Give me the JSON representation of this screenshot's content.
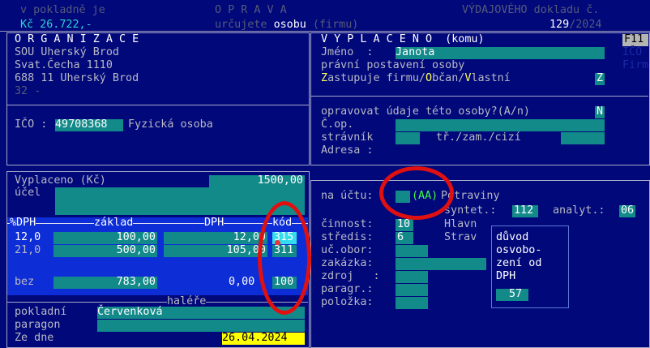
{
  "top": {
    "left_line1": "v pokladně je",
    "left_line2": "Kč 26.722,-",
    "title": "O P R A V A",
    "subtitle_pre": "určujete ",
    "subtitle_hl": "osobu",
    "subtitle_post": " (firmu)",
    "doc_label": "VÝDAJOVÉHO dokladu č.",
    "doc_number": "129",
    "doc_year": "/2024"
  },
  "org": {
    "title": "O R G A N I Z A C E",
    "name": "SOU Uherský Brod",
    "street": "Svat.Čecha 1110",
    "city": "688 11 Uherský Brod",
    "code": "32 -",
    "ico_label": "IČO :",
    "ico_value": "49708368",
    "ico_type": "Fyzická osoba"
  },
  "payee": {
    "title": "V Y P L A C E N O  (komu)",
    "f11": "F11",
    "side1": "IČO",
    "side2": "Firm",
    "jmeno_label": "Jméno  :",
    "jmeno_value": "Janota",
    "pravni": "právní postavení osoby",
    "z1": "Z",
    "z1_rest": "astupuje firmu/",
    "z2": "O",
    "z2_rest": "bčan/",
    "z3": "V",
    "z3_rest": "lastní",
    "z_value": "Z",
    "question": "opravovat údaje této osoby?(A/n)",
    "answer": "N",
    "cop_label": "Č.op.",
    "stravnik_label": "strávník",
    "stravnik_opts": "tř./zam./cizí",
    "adresa_label": "Adresa :"
  },
  "payment": {
    "vyplaceno_label": "Vyplaceno (Kč)",
    "vyplaceno_value": "1500,00",
    "ucel_label": "účel",
    "headers": {
      "dph_pct": "%DPH",
      "zaklad": "základ",
      "dph": "DPH",
      "kod": "kód"
    },
    "rows": [
      {
        "pct": "12,0",
        "zaklad": "100,00",
        "dph": "12,00",
        "kod": "315"
      },
      {
        "pct": "21,0",
        "zaklad": "500,00",
        "dph": "105,00",
        "kod": "311"
      }
    ],
    "bez_label": "bez",
    "bez_value": "783,00",
    "bez_dph": "0,00",
    "bez_kod": "100",
    "halire": "haléře",
    "pokladni_label": "pokladní",
    "pokladni_value": "Červenková",
    "paragon_label": "paragon",
    "zedne_label": "Ze dne",
    "zedne_value": "26.04.2024"
  },
  "account": {
    "na_uctu": "na účtu:",
    "aa": "(AA)",
    "potraviny": "Potraviny",
    "syntet_label": "syntet.:",
    "syntet_value": "112",
    "analyt_label": "analyt.:",
    "analyt_value": "06",
    "cinnost_label": "činnost:",
    "cinnost_value": "10",
    "hlavn": "Hlavn",
    "stredis_label": "středis:",
    "stredis_value": "6",
    "strav": "Strav",
    "ucobor_label": "uč.obor:",
    "zakazka_label": "zakázka:",
    "zdroj_label": "zdroj   :",
    "paragr_label": "paragr.:",
    "polozka_label": "položka:",
    "duvod_l1": "důvod",
    "duvod_l2": "osvobo-",
    "duvod_l3": "zení od",
    "duvod_l4": "DPH",
    "duvod_value": "57"
  }
}
